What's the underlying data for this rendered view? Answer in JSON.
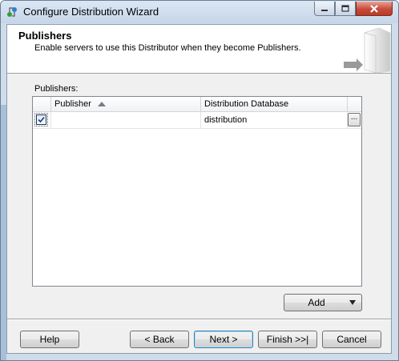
{
  "window": {
    "title": "Configure Distribution Wizard"
  },
  "header": {
    "title": "Publishers",
    "subtitle": "Enable servers to use this Distributor when they become Publishers."
  },
  "publishers": {
    "label": "Publishers:",
    "columns": [
      "Publisher",
      "Distribution Database"
    ],
    "sort_column": "Publisher",
    "rows": [
      {
        "checked": true,
        "publisher": "",
        "distribution_database": "distribution",
        "browse_label": "..."
      }
    ]
  },
  "actions": {
    "add_label": "Add"
  },
  "footer": {
    "help_label": "Help",
    "back_label": "< Back",
    "next_label": "Next >",
    "finish_label": "Finish >>|",
    "cancel_label": "Cancel"
  },
  "icons": {
    "title": "wizard-icon",
    "minimize": "minimize-icon",
    "maximize": "maximize-icon",
    "close": "close-icon",
    "header_art": "server-icon",
    "sort": "sort-ascending-icon",
    "dropdown": "chevron-down-icon",
    "checkbox": "checkmark-icon"
  },
  "colors": {
    "titlebar": "#cfdcea",
    "close_button": "#c74b3a",
    "default_button_border": "#3c7fb1",
    "dialog_background": "#f0f0f0"
  }
}
